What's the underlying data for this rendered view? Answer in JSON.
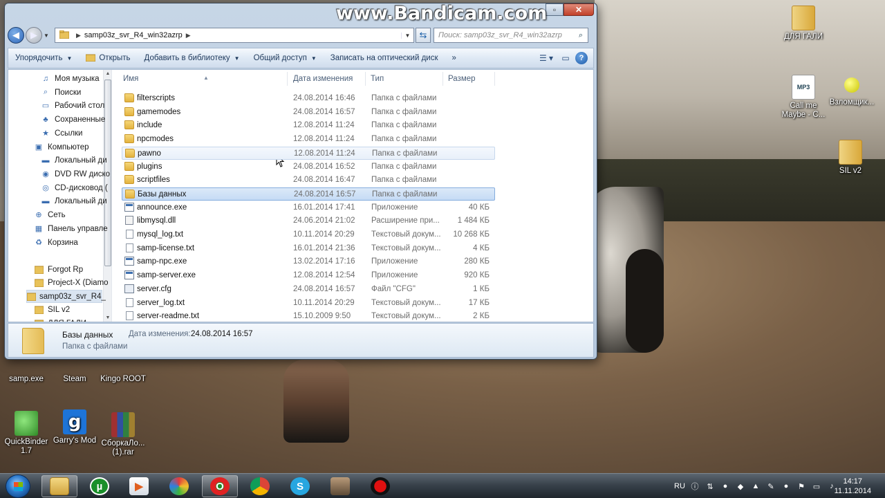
{
  "overlay": {
    "watermark": "www.Bandicam.com"
  },
  "window": {
    "controls": {
      "minimize": "▫",
      "close": "✕"
    },
    "address": {
      "segment": "samp03z_svr_R4_win32azrp"
    },
    "search": {
      "placeholder": "Поиск: samp03z_svr_R4_win32azrp"
    },
    "toolbar": {
      "organize": "Упорядочить",
      "open": "Открыть",
      "add_to_library": "Добавить в библиотеку",
      "share": "Общий доступ",
      "burn": "Записать на оптический диск",
      "more": "»"
    },
    "nav": [
      {
        "label": "Моя музыка",
        "icon": "music-folder-icon",
        "glyph": "♫"
      },
      {
        "label": "Поиски",
        "icon": "search-folder-icon",
        "glyph": "⌕"
      },
      {
        "label": "Рабочий стол",
        "icon": "desktop-icon",
        "glyph": "▭"
      },
      {
        "label": "Сохраненные",
        "icon": "saved-games-icon",
        "glyph": "♣"
      },
      {
        "label": "Ссылки",
        "icon": "links-icon",
        "glyph": "★"
      },
      {
        "label": "Компьютер",
        "icon": "computer-icon",
        "glyph": "▣"
      },
      {
        "label": "Локальный ди",
        "icon": "local-disk-icon",
        "glyph": "▬"
      },
      {
        "label": "DVD RW диско",
        "icon": "dvd-drive-icon",
        "glyph": "◉"
      },
      {
        "label": "CD-дисковод (",
        "icon": "cd-drive-icon",
        "glyph": "◎"
      },
      {
        "label": "Локальный ди",
        "icon": "local-disk-icon",
        "glyph": "▬"
      },
      {
        "label": "Сеть",
        "icon": "network-icon",
        "glyph": "⊕"
      },
      {
        "label": "Панель управле",
        "icon": "control-panel-icon",
        "glyph": "▦"
      },
      {
        "label": "Корзина",
        "icon": "recycle-bin-icon",
        "glyph": "♻"
      },
      {
        "label": "Forgot Rp",
        "icon": "folder-icon",
        "glyph": ""
      },
      {
        "label": "Project-X (Diamo",
        "icon": "folder-icon",
        "glyph": ""
      },
      {
        "label": "samp03z_svr_R4_",
        "icon": "folder-icon",
        "glyph": ""
      },
      {
        "label": "SIL v2",
        "icon": "folder-icon",
        "glyph": ""
      },
      {
        "label": "ДЛЯ ГАЛИ",
        "icon": "folder-icon",
        "glyph": ""
      }
    ],
    "columns": {
      "name": "Имя",
      "date": "Дата изменения",
      "type": "Тип",
      "size": "Размер"
    },
    "files": [
      {
        "name": "filterscripts",
        "date": "24.08.2014 16:46",
        "type": "Папка с файлами",
        "size": "",
        "kind": "folder"
      },
      {
        "name": "gamemodes",
        "date": "24.08.2014 16:57",
        "type": "Папка с файлами",
        "size": "",
        "kind": "folder"
      },
      {
        "name": "include",
        "date": "12.08.2014 11:24",
        "type": "Папка с файлами",
        "size": "",
        "kind": "folder"
      },
      {
        "name": "npcmodes",
        "date": "12.08.2014 11:24",
        "type": "Папка с файлами",
        "size": "",
        "kind": "folder"
      },
      {
        "name": "pawno",
        "date": "12.08.2014 11:24",
        "type": "Папка с файлами",
        "size": "",
        "kind": "folder"
      },
      {
        "name": "plugins",
        "date": "24.08.2014 16:52",
        "type": "Папка с файлами",
        "size": "",
        "kind": "folder"
      },
      {
        "name": "scriptfiles",
        "date": "24.08.2014 16:47",
        "type": "Папка с файлами",
        "size": "",
        "kind": "folder"
      },
      {
        "name": "Базы данных",
        "date": "24.08.2014 16:57",
        "type": "Папка с файлами",
        "size": "",
        "kind": "folder"
      },
      {
        "name": "announce.exe",
        "date": "16.01.2014 17:41",
        "type": "Приложение",
        "size": "40 КБ",
        "kind": "exe"
      },
      {
        "name": "libmysql.dll",
        "date": "24.06.2014 21:02",
        "type": "Расширение при...",
        "size": "1 484 КБ",
        "kind": "dll"
      },
      {
        "name": "mysql_log.txt",
        "date": "10.11.2014 20:29",
        "type": "Текстовый докум...",
        "size": "10 268 КБ",
        "kind": "file"
      },
      {
        "name": "samp-license.txt",
        "date": "16.01.2014 21:36",
        "type": "Текстовый докум...",
        "size": "4 КБ",
        "kind": "file"
      },
      {
        "name": "samp-npc.exe",
        "date": "13.02.2014 17:16",
        "type": "Приложение",
        "size": "280 КБ",
        "kind": "exe"
      },
      {
        "name": "samp-server.exe",
        "date": "12.08.2014 12:54",
        "type": "Приложение",
        "size": "920 КБ",
        "kind": "exe"
      },
      {
        "name": "server.cfg",
        "date": "24.08.2014 16:57",
        "type": "Файл \"CFG\"",
        "size": "1 КБ",
        "kind": "cfg"
      },
      {
        "name": "server_log.txt",
        "date": "10.11.2014 20:29",
        "type": "Текстовый докум...",
        "size": "17 КБ",
        "kind": "file"
      },
      {
        "name": "server-readme.txt",
        "date": "15.10.2009 9:50",
        "type": "Текстовый докум...",
        "size": "2 КБ",
        "kind": "file"
      }
    ],
    "details": {
      "name": "Базы данных",
      "modified_label": "Дата изменения:",
      "modified_value": "24.08.2014 16:57",
      "type": "Папка с файлами"
    }
  },
  "desktop": {
    "icons": [
      {
        "label": "ДЛЯ ГАЛИ",
        "kind": "folder",
        "glyph": ""
      },
      {
        "label": "Call me Maybe - C...",
        "kind": "mp3",
        "glyph": "MP3"
      },
      {
        "label": "Взломщик...",
        "kind": "ball",
        "glyph": ""
      },
      {
        "label": "SIL v2",
        "kind": "folder",
        "glyph": ""
      },
      {
        "label": "samp.exe",
        "kind": "app",
        "glyph": ""
      },
      {
        "label": "Steam",
        "kind": "app",
        "glyph": ""
      },
      {
        "label": "Kingo ROOT",
        "kind": "app",
        "glyph": ""
      },
      {
        "label": "QuickBinder 1.7",
        "kind": "qb",
        "glyph": ""
      },
      {
        "label": "Garry's Mod",
        "kind": "gm",
        "glyph": "g"
      },
      {
        "label": "СборкаЛо... (1).rar",
        "kind": "rar",
        "glyph": ""
      }
    ]
  },
  "taskbar": {
    "apps": [
      {
        "name": "explorer",
        "glyph": "",
        "active": true
      },
      {
        "name": "utorrent",
        "glyph": "µ",
        "active": false
      },
      {
        "name": "media-player",
        "glyph": "▶",
        "active": false
      },
      {
        "name": "gem-app",
        "glyph": "",
        "active": false
      },
      {
        "name": "opera",
        "glyph": "O",
        "active": true
      },
      {
        "name": "chrome",
        "glyph": "",
        "active": false
      },
      {
        "name": "skype",
        "glyph": "S",
        "active": false
      },
      {
        "name": "samp",
        "glyph": "",
        "active": false
      },
      {
        "name": "bandicam",
        "glyph": "",
        "active": false
      }
    ],
    "lang": "RU",
    "time": "14:17",
    "date": "11.11.2014"
  }
}
